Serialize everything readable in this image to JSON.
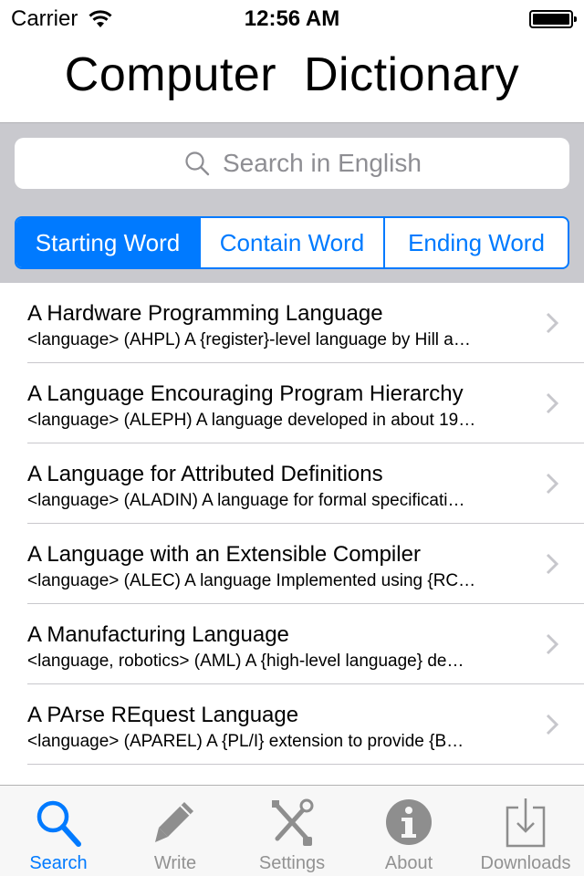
{
  "status_bar": {
    "carrier": "Carrier",
    "time": "12:56 AM",
    "battery_level": 1.0
  },
  "header": {
    "title": "Computer  Dictionary"
  },
  "search": {
    "placeholder": "Search in English",
    "value": ""
  },
  "segments": {
    "items": [
      {
        "label": "Starting Word",
        "selected": true
      },
      {
        "label": "Contain Word",
        "selected": false
      },
      {
        "label": "Ending Word",
        "selected": false
      }
    ]
  },
  "list": {
    "items": [
      {
        "title": "A Hardware Programming Language",
        "subtitle": "<language> (AHPL) A {register}-level language by Hill a…"
      },
      {
        "title": "A Language Encouraging Program Hierarchy",
        "subtitle": "<language> (ALEPH) A language developed in about 19…"
      },
      {
        "title": "A Language for Attributed Definitions",
        "subtitle": "<language> (ALADIN) A language for formal specificati…"
      },
      {
        "title": "A Language with an Extensible Compiler",
        "subtitle": "<language> (ALEC) A language Implemented using {RC…"
      },
      {
        "title": "A Manufacturing Language",
        "subtitle": "<language, robotics> (AML) A {high-level language} de…"
      },
      {
        "title": "A PArse REquest Language",
        "subtitle": "<language> (APAREL) A {PL/I} extension to provide {B…"
      }
    ]
  },
  "tab_bar": {
    "items": [
      {
        "label": "Search",
        "icon": "magnifier-icon",
        "active": true
      },
      {
        "label": "Write",
        "icon": "pencil-icon",
        "active": false
      },
      {
        "label": "Settings",
        "icon": "tools-icon",
        "active": false
      },
      {
        "label": "About",
        "icon": "info-icon",
        "active": false
      },
      {
        "label": "Downloads",
        "icon": "download-icon",
        "active": false
      }
    ]
  },
  "colors": {
    "accent": "#007aff",
    "inactive_tab": "#929292",
    "search_area_bg": "#c9c9ce"
  }
}
